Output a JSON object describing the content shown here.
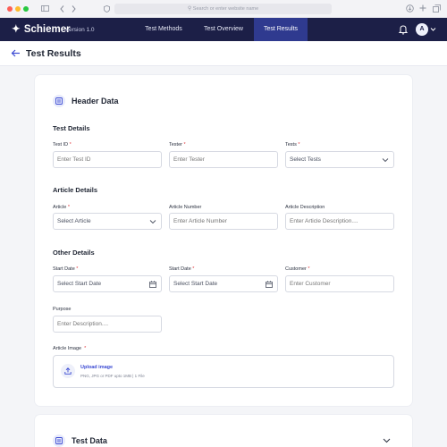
{
  "browser": {
    "url_placeholder": "Search or enter website name"
  },
  "nav": {
    "brand": "Schiemer",
    "version": "Version 1.0",
    "tabs": [
      {
        "label": "Test Methods"
      },
      {
        "label": "Test Overview"
      },
      {
        "label": "Test Results",
        "active": true
      }
    ],
    "avatar_initial": "A"
  },
  "page": {
    "title": "Test Results"
  },
  "header_card": {
    "title": "Header Data",
    "sections": {
      "test_details": "Test Details",
      "article_details": "Article Details",
      "other_details": "Other Details"
    },
    "fields": {
      "test_id": {
        "label": "Test ID",
        "placeholder": "Enter Test ID"
      },
      "tester": {
        "label": "Tester",
        "placeholder": "Enter Tester"
      },
      "tests": {
        "label": "Tests",
        "value": "Select Tests"
      },
      "article": {
        "label": "Article",
        "value": "Select Article"
      },
      "article_number": {
        "label": "Article Number",
        "placeholder": "Enter Article Number"
      },
      "article_description": {
        "label": "Article Description",
        "placeholder": "Enter Article Description...."
      },
      "start_date_1": {
        "label": "Start Date",
        "value": "Select Start Date"
      },
      "start_date_2": {
        "label": "Start Date",
        "value": "Select Start Date"
      },
      "customer": {
        "label": "Customer",
        "placeholder": "Enter Customer"
      },
      "purpose": {
        "label": "Purpose",
        "placeholder": "Enter Description...."
      },
      "article_image": {
        "label": "Article Image"
      }
    },
    "required_mark": "*",
    "upload": {
      "title": "Upload image",
      "hint": "PNG, JPG or PDF upto 1MB | 1 File"
    }
  },
  "test_card": {
    "title": "Test Data"
  },
  "colors": {
    "nav_bg": "#1c1f47",
    "nav_active": "#2f3a8f",
    "accent": "#3b4ad3",
    "required": "#e0393e"
  }
}
